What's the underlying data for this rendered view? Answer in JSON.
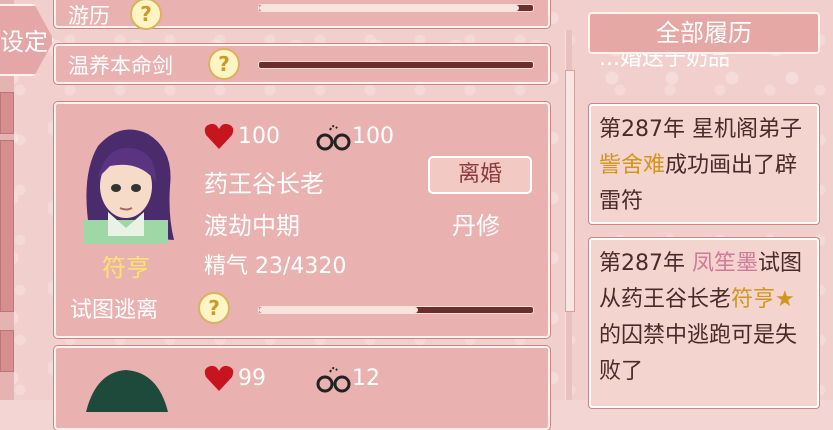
{
  "setting_tab": {
    "label": "设定"
  },
  "rows": [
    {
      "label": "游历",
      "progress": 0.95
    },
    {
      "label": "温养本命剑",
      "progress": 0.0
    }
  ],
  "cards": [
    {
      "name": "符亨",
      "health": "100",
      "restraint": "100",
      "faction_role": "药王谷长老",
      "realm": "渡劫中期",
      "spirit_label": "精气",
      "spirit_value": "23/4320",
      "divorce_label": "离婚",
      "cultivation": "丹修",
      "action_label": "试图逃离",
      "action_progress": 0.58
    },
    {
      "health": "99",
      "restraint": "12"
    }
  ],
  "history": {
    "button_label": "全部履历",
    "partial_entry": "...婚送于奶品",
    "entries": [
      {
        "pre": "第287年 星机阁弟子",
        "name": "訾舍难",
        "post": "成功画出了辟雷符"
      },
      {
        "pre": "第287年 ",
        "name": "凤笙墨",
        "mid": "试图从药王谷长老",
        "name2": "符亨",
        "star": "★",
        "post": "的囚禁中逃跑可是失败了"
      }
    ]
  },
  "icons": {
    "question": "?",
    "heart": "heart-icon",
    "handcuffs": "handcuffs-icon"
  },
  "colors": {
    "accent": "#eab1b1",
    "highlight_name": "#ffe36d",
    "log_name_yellow": "#d1961c",
    "log_name_pink": "#d07a9a"
  }
}
